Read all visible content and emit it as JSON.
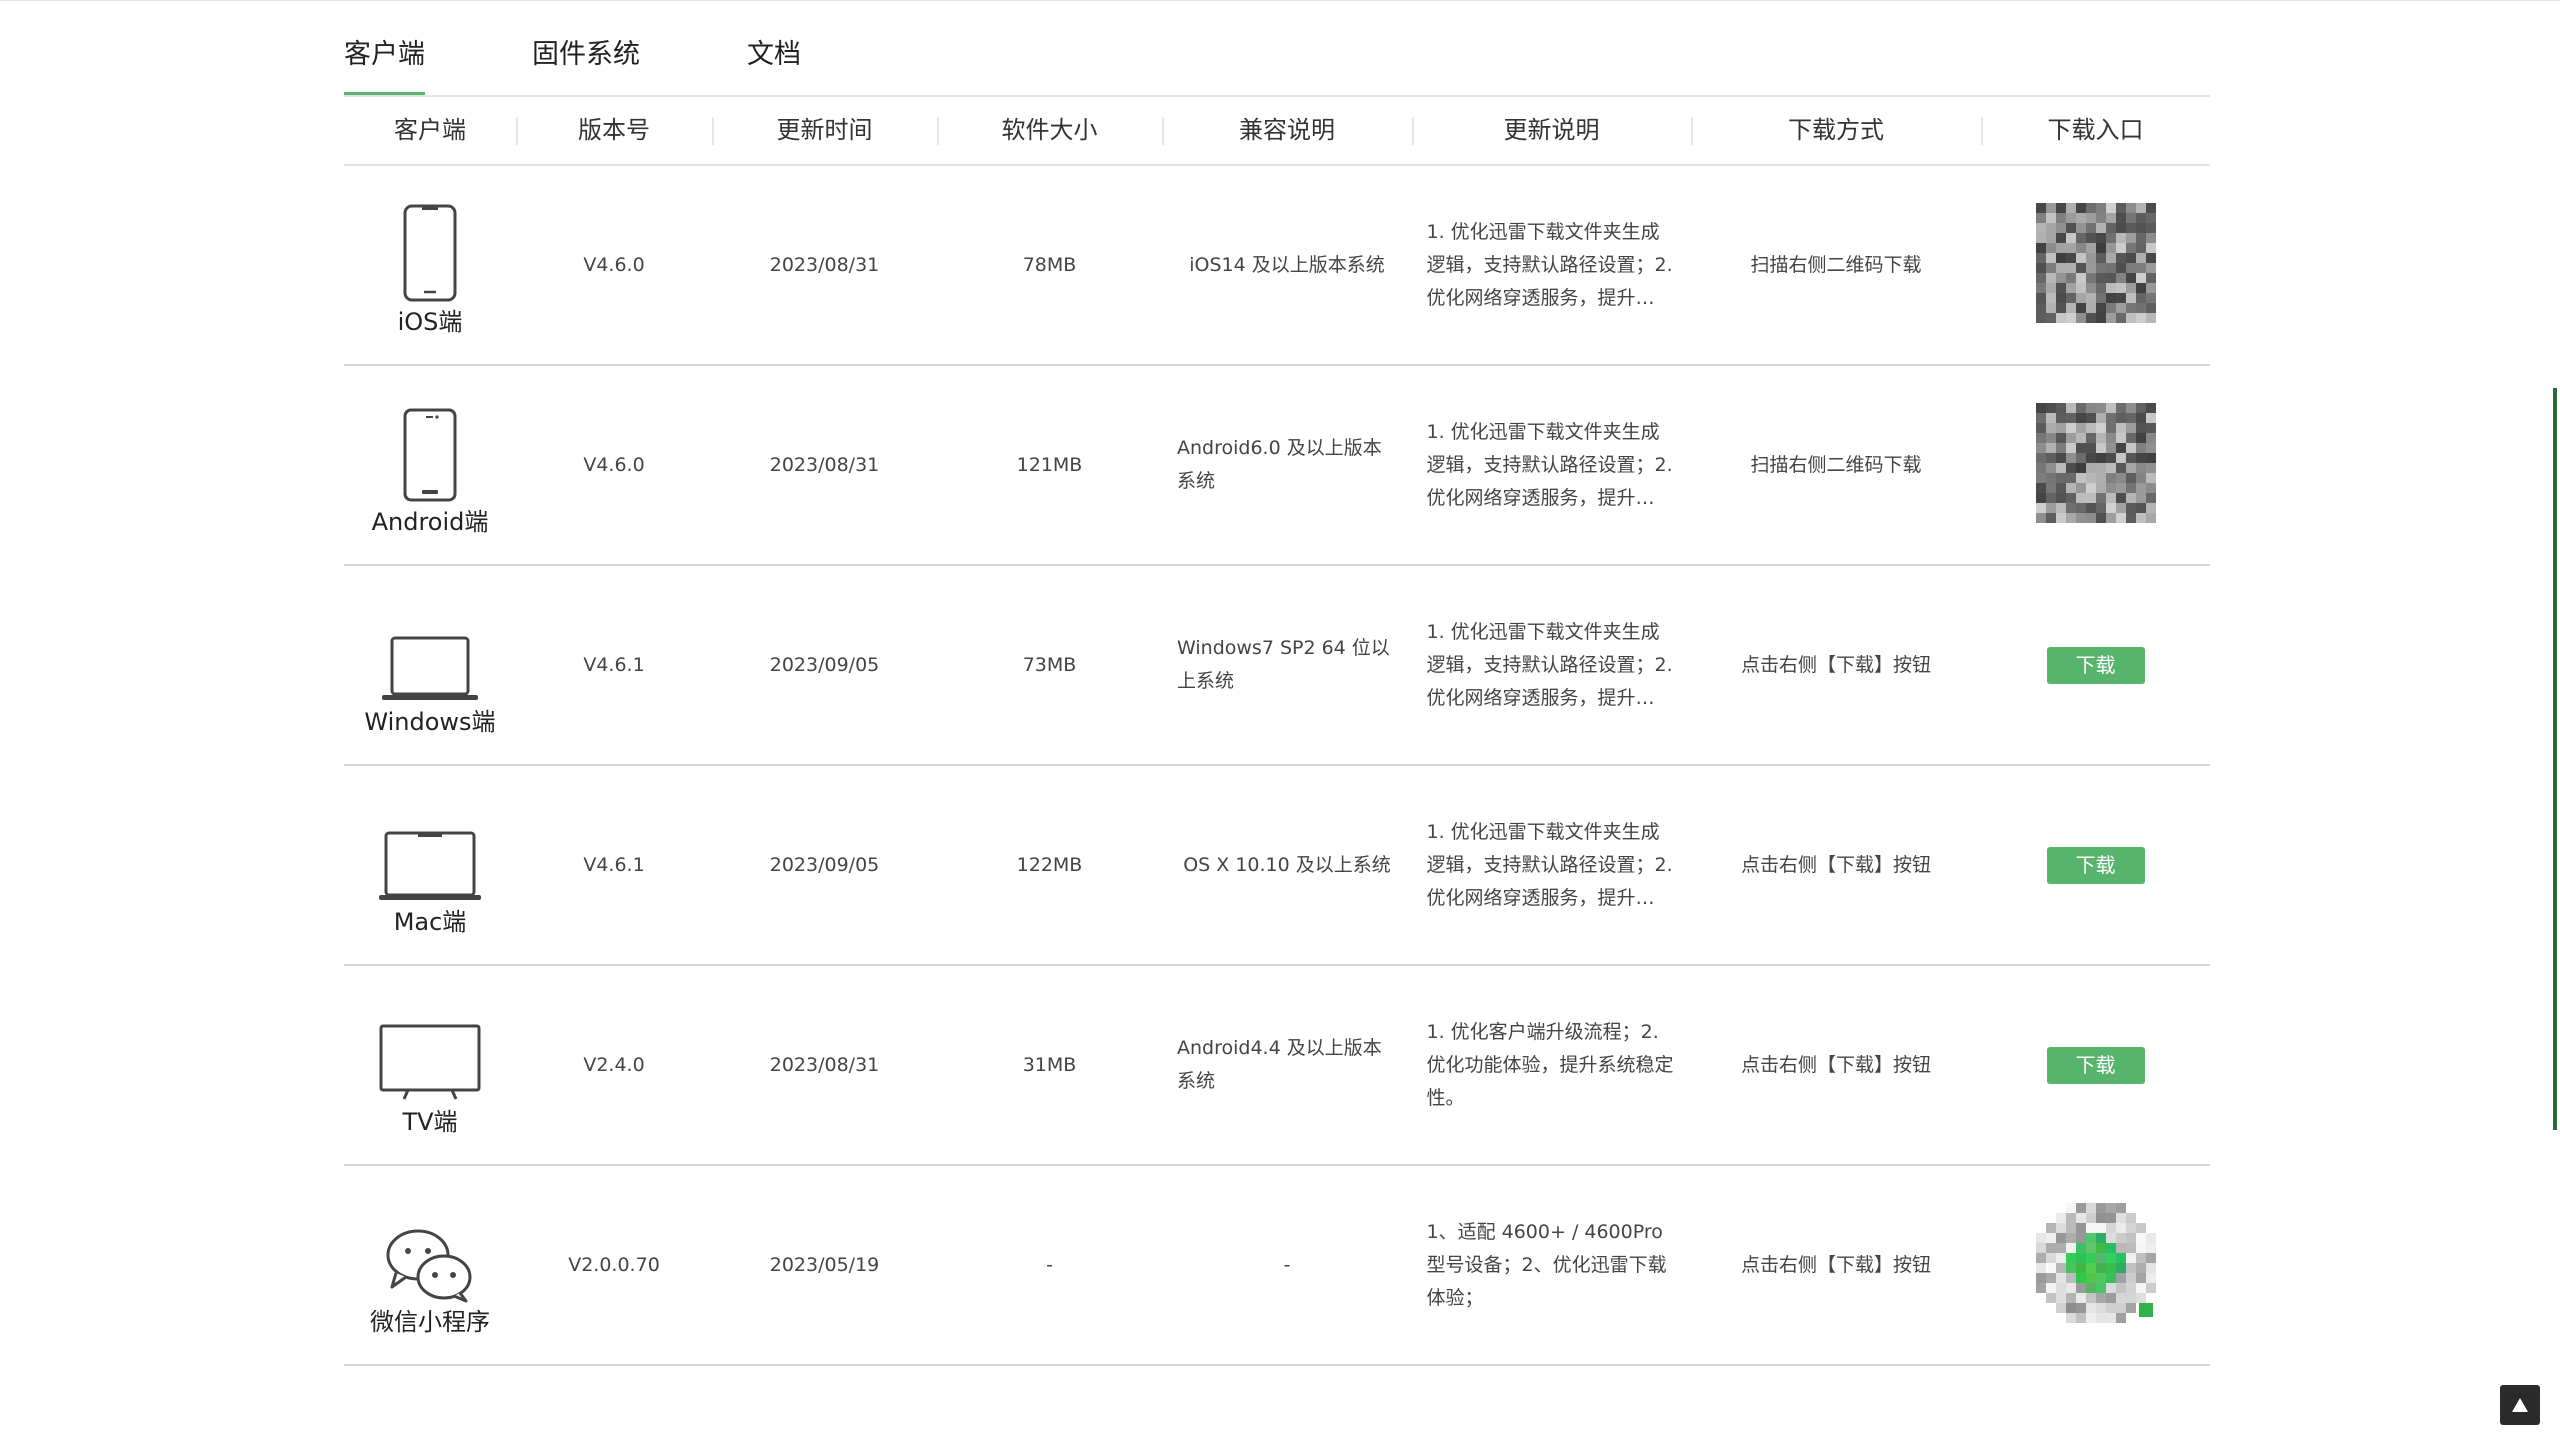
{
  "tabs": [
    {
      "label": "客户端",
      "active": true
    },
    {
      "label": "固件系统",
      "active": false
    },
    {
      "label": "文档",
      "active": false
    }
  ],
  "table": {
    "headers": [
      "客户端",
      "版本号",
      "更新时间",
      "软件大小",
      "兼容说明",
      "更新说明",
      "下载方式",
      "下载入口"
    ],
    "rows": [
      {
        "platform": "iOS端",
        "icon": "phone-icon",
        "version": "V4.6.0",
        "date": "2023/08/31",
        "size": "78MB",
        "compat": "iOS14 及以上版本系统",
        "notes": "1. 优化迅雷下载文件夹生成逻辑，支持默认路径设置；2. 优化网络穿透服务，提升…",
        "method": "扫描右侧二维码下载",
        "entry": {
          "type": "qr",
          "color": "#555555"
        }
      },
      {
        "platform": "Android端",
        "icon": "android-phone-icon",
        "version": "V4.6.0",
        "date": "2023/08/31",
        "size": "121MB",
        "compat": "Android6.0 及以上版本系统",
        "notes": "1. 优化迅雷下载文件夹生成逻辑，支持默认路径设置；2. 优化网络穿透服务，提升…",
        "method": "扫描右侧二维码下载",
        "entry": {
          "type": "qr",
          "color": "#555555"
        }
      },
      {
        "platform": "Windows端",
        "icon": "laptop-icon",
        "version": "V4.6.1",
        "date": "2023/09/05",
        "size": "73MB",
        "compat": "Windows7 SP2 64 位以上系统",
        "notes": "1. 优化迅雷下载文件夹生成逻辑，支持默认路径设置；2. 优化网络穿透服务，提升…",
        "method": "点击右侧【下载】按钮",
        "entry": {
          "type": "button",
          "label": "下载"
        }
      },
      {
        "platform": "Mac端",
        "icon": "macbook-icon",
        "version": "V4.6.1",
        "date": "2023/09/05",
        "size": "122MB",
        "compat": "OS X 10.10 及以上系统",
        "notes": "1. 优化迅雷下载文件夹生成逻辑，支持默认路径设置；2. 优化网络穿透服务，提升…",
        "method": "点击右侧【下载】按钮",
        "entry": {
          "type": "button",
          "label": "下载"
        }
      },
      {
        "platform": "TV端",
        "icon": "tv-icon",
        "version": "V2.4.0",
        "date": "2023/08/31",
        "size": "31MB",
        "compat": "Android4.4 及以上版本系统",
        "notes": "1. 优化客户端升级流程；2. 优化功能体验，提升系统稳定性。",
        "method": "点击右侧【下载】按钮",
        "entry": {
          "type": "button",
          "label": "下载"
        }
      },
      {
        "platform": "微信小程序",
        "icon": "wechat-icon",
        "version": "V2.0.0.70",
        "date": "2023/05/19",
        "size": "-",
        "compat": "-",
        "notes": "1、适配 4600+ / 4600Pro 型号设备；2、优化迅雷下载体验；",
        "method": "点击右侧【下载】按钮",
        "entry": {
          "type": "qr-wechat",
          "color": "#2fb34a"
        }
      }
    ]
  },
  "back_to_top": {
    "icon": "arrow-up-icon"
  },
  "colors": {
    "accent": "#56b46d",
    "divider": "#e3e3e3",
    "scroll_accent": "#2d6a3a"
  }
}
